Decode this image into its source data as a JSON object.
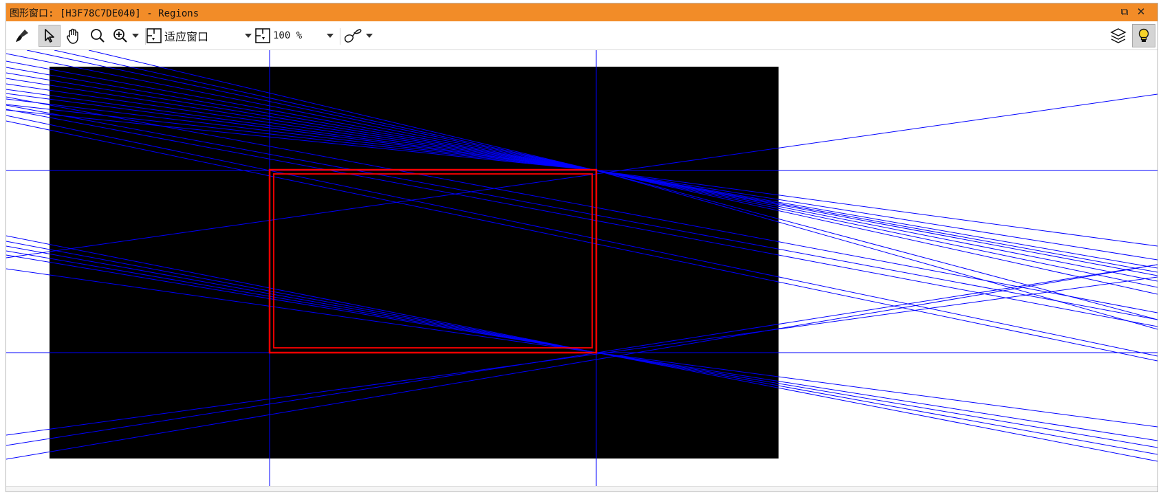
{
  "window": {
    "title": "图形窗口: [H3F78C7DE040] - Regions",
    "restore_label": "⧉",
    "close_label": "✕",
    "accent": "#f28c28"
  },
  "toolbar": {
    "clear_icon": "brush-icon",
    "select_icon": "pointer-icon",
    "pan_icon": "hand-icon",
    "magnify_icon": "magnifier-icon",
    "zoom_icon": "zoom-in-icon",
    "fit_label": "适应窗口",
    "zoom_value": "100 %",
    "draw_icon": "freehand-icon",
    "layers_icon": "layers-icon",
    "bulb_icon": "lightbulb-icon"
  },
  "canvas": {
    "background": "#ffffff",
    "image_color": "#000000",
    "line_color": "#0000ff",
    "region_color": "#ff0000"
  }
}
